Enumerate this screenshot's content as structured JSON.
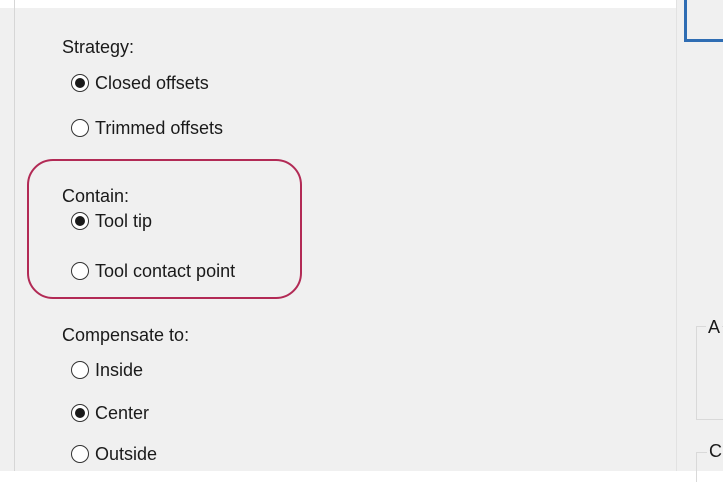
{
  "strategy": {
    "label": "Strategy:",
    "options": [
      {
        "label": "Closed offsets",
        "checked": true
      },
      {
        "label": "Trimmed offsets",
        "checked": false
      }
    ]
  },
  "contain": {
    "label": "Contain:",
    "options": [
      {
        "label": "Tool tip",
        "checked": true
      },
      {
        "label": "Tool contact point",
        "checked": false
      }
    ]
  },
  "compensate": {
    "label": "Compensate to:",
    "options": [
      {
        "label": "Inside",
        "checked": false
      },
      {
        "label": "Center",
        "checked": true
      },
      {
        "label": "Outside",
        "checked": false
      }
    ]
  },
  "right_pane": {
    "group_a_label": "A",
    "group_c_label": "C"
  },
  "colors": {
    "highlight": "#b22a55",
    "accent": "#2f6db3"
  }
}
